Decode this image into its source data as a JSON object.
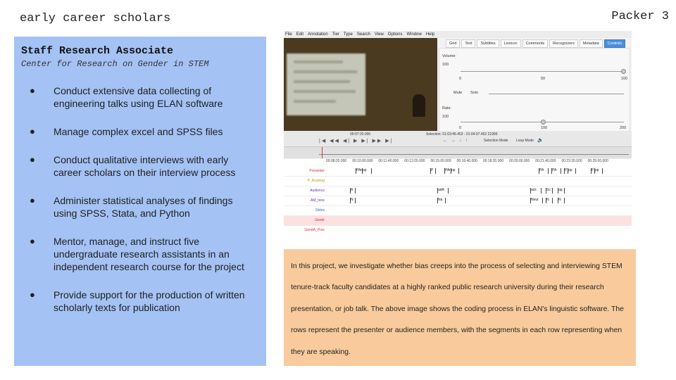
{
  "header": {
    "title": "early career scholars",
    "page_label": "Packer 3"
  },
  "position": {
    "title": "Staff Research Associate",
    "organization": "Center for Research on Gender in STEM",
    "duties": [
      "Conduct extensive data collecting of engineering talks using ELAN software",
      "Manage complex excel and SPSS files",
      "Conduct qualitative interviews with early career scholars on their interview process",
      "Administer statistical analyses of findings using SPSS, Stata, and Python",
      "Mentor, manage, and instruct  five undergraduate research assistants in an independent research course for the project",
      "Provide support for the production of written scholarly texts for publication"
    ]
  },
  "elan": {
    "menu": [
      "File",
      "Edit",
      "Annotation",
      "Tier",
      "Type",
      "Search",
      "View",
      "Options",
      "Window",
      "Help"
    ],
    "tabs": [
      "Grid",
      "Text",
      "Subtitles",
      "Lexicon",
      "Comments",
      "Recognizers",
      "Metadata",
      "Controls"
    ],
    "active_tab": "Controls",
    "volume_label": "Volume:",
    "volume_value": "100",
    "volume_ticks": [
      "0",
      "50",
      "100"
    ],
    "mute_label": "Mute",
    "solo_label": "Solo",
    "rate_label": "Rate:",
    "rate_value": "100",
    "rate_ticks": [
      "0",
      "100",
      "200"
    ],
    "time_display": "00:07:20.000",
    "selection": "Selection: 01:03:45.453 - 01:04:07.452  21999",
    "selection_mode": "Selection Mode",
    "loop_mode": "Loop Mode",
    "tiers": [
      "Presenter",
      "P_Rushing",
      "Audience",
      "AM_tone",
      "Slides",
      "Gendr",
      "GendA_Prec"
    ],
    "time_labels": [
      "00:08:20.000",
      "00:10:00.000",
      "00:11:40.000",
      "00:13:20.000",
      "00:15:00.000",
      "00:16:40.000",
      "00:18:20.000",
      "00:20:00.000",
      "00:21:40.000",
      "00:23:20.000",
      "00:25:00.000"
    ],
    "segments": {
      "presenter": [
        "PAn",
        "pp",
        "P",
        "PAn",
        "pp",
        "PA",
        "PA",
        "P",
        "pp",
        "P",
        "pp"
      ],
      "audience": [
        "A",
        "adA",
        "ack",
        "Sc",
        "qq"
      ],
      "am_tone": [
        "N",
        "Na",
        "Neut",
        "N",
        "N"
      ]
    }
  },
  "description": "In this project, we investigate whether bias creeps into the process of selecting and interviewing STEM tenure-track faculty candidates at a highly ranked public research university during their research presentation, or job talk. The above image shows the coding process in ELAN's linguistic software. The rows represent the presenter or audience members, with the segments in each row representing when they are speaking.",
  "colors": {
    "left_panel": "#a4c2f4",
    "desc_panel": "#f9cb9c",
    "active_tab": "#4a90d9"
  }
}
